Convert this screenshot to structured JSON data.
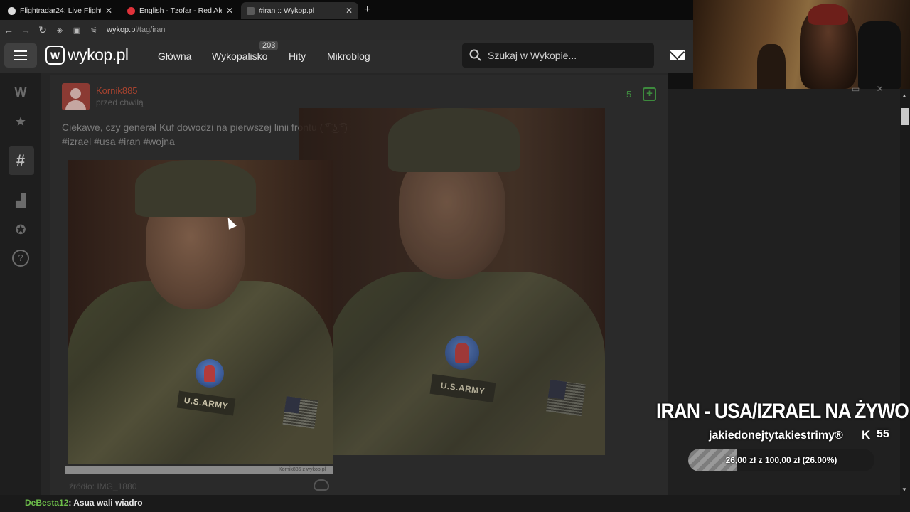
{
  "browser": {
    "tabs": [
      {
        "label": "Flightradar24: Live Flight Tracker",
        "favicon_color": "#dcdcdc",
        "active": false
      },
      {
        "label": "English - Tzofar - Red Alert",
        "favicon_color": "#e0323a",
        "active": false
      },
      {
        "label": "#iran :: Wykop.pl",
        "favicon_color": "#5a5a5a",
        "active": true
      }
    ],
    "tab_close_glyph": "✕",
    "new_tab_glyph": "+",
    "url_domain": "wykop.pl",
    "url_path": "/tag/iran"
  },
  "header": {
    "logo_text": "wykop.pl",
    "logo_badge": "W",
    "nav": [
      {
        "label": "Główna"
      },
      {
        "label": "Wykopalisko",
        "count": "203"
      },
      {
        "label": "Hity"
      },
      {
        "label": "Mikroblog"
      }
    ],
    "search_placeholder": "Szukaj w Wykopie..."
  },
  "sidebar": {
    "icons": [
      "wykop-icon",
      "star-icon",
      "hashtag-icon",
      "ranking-icon",
      "medal-icon",
      "help-icon"
    ],
    "active": "hashtag-icon"
  },
  "post": {
    "author": "Kornik885",
    "time": "przed chwilą",
    "votes": "5",
    "text": "Ciekawe, czy generał Kuf dowodzi na pierwszej linii frontu ( ͡° ͜ʖ ͡°)",
    "tags": "#izrael #usa #iran #wojna",
    "image_badge": "U.S.ARMY",
    "image_footer": "Kornik885 z wykop.pl",
    "source": "źródło: IMG_1880"
  },
  "stream": {
    "title": "IRAN - USA/IZRAEL NA ŻYWO",
    "channel": "jakiedonejtytakiestrimy®",
    "kick_glyph": "K",
    "viewers": "55",
    "donation_text": "26,00 zł z 100,00 zł (26.00%)",
    "donation_progress": 0.26
  },
  "chat": {
    "user": "DeBesta12",
    "message": ": Asua wali wiadro"
  },
  "colors": {
    "accent_green": "#3d8a3d",
    "author_red": "#a8432f",
    "chat_user_green": "#6dbd4a"
  }
}
